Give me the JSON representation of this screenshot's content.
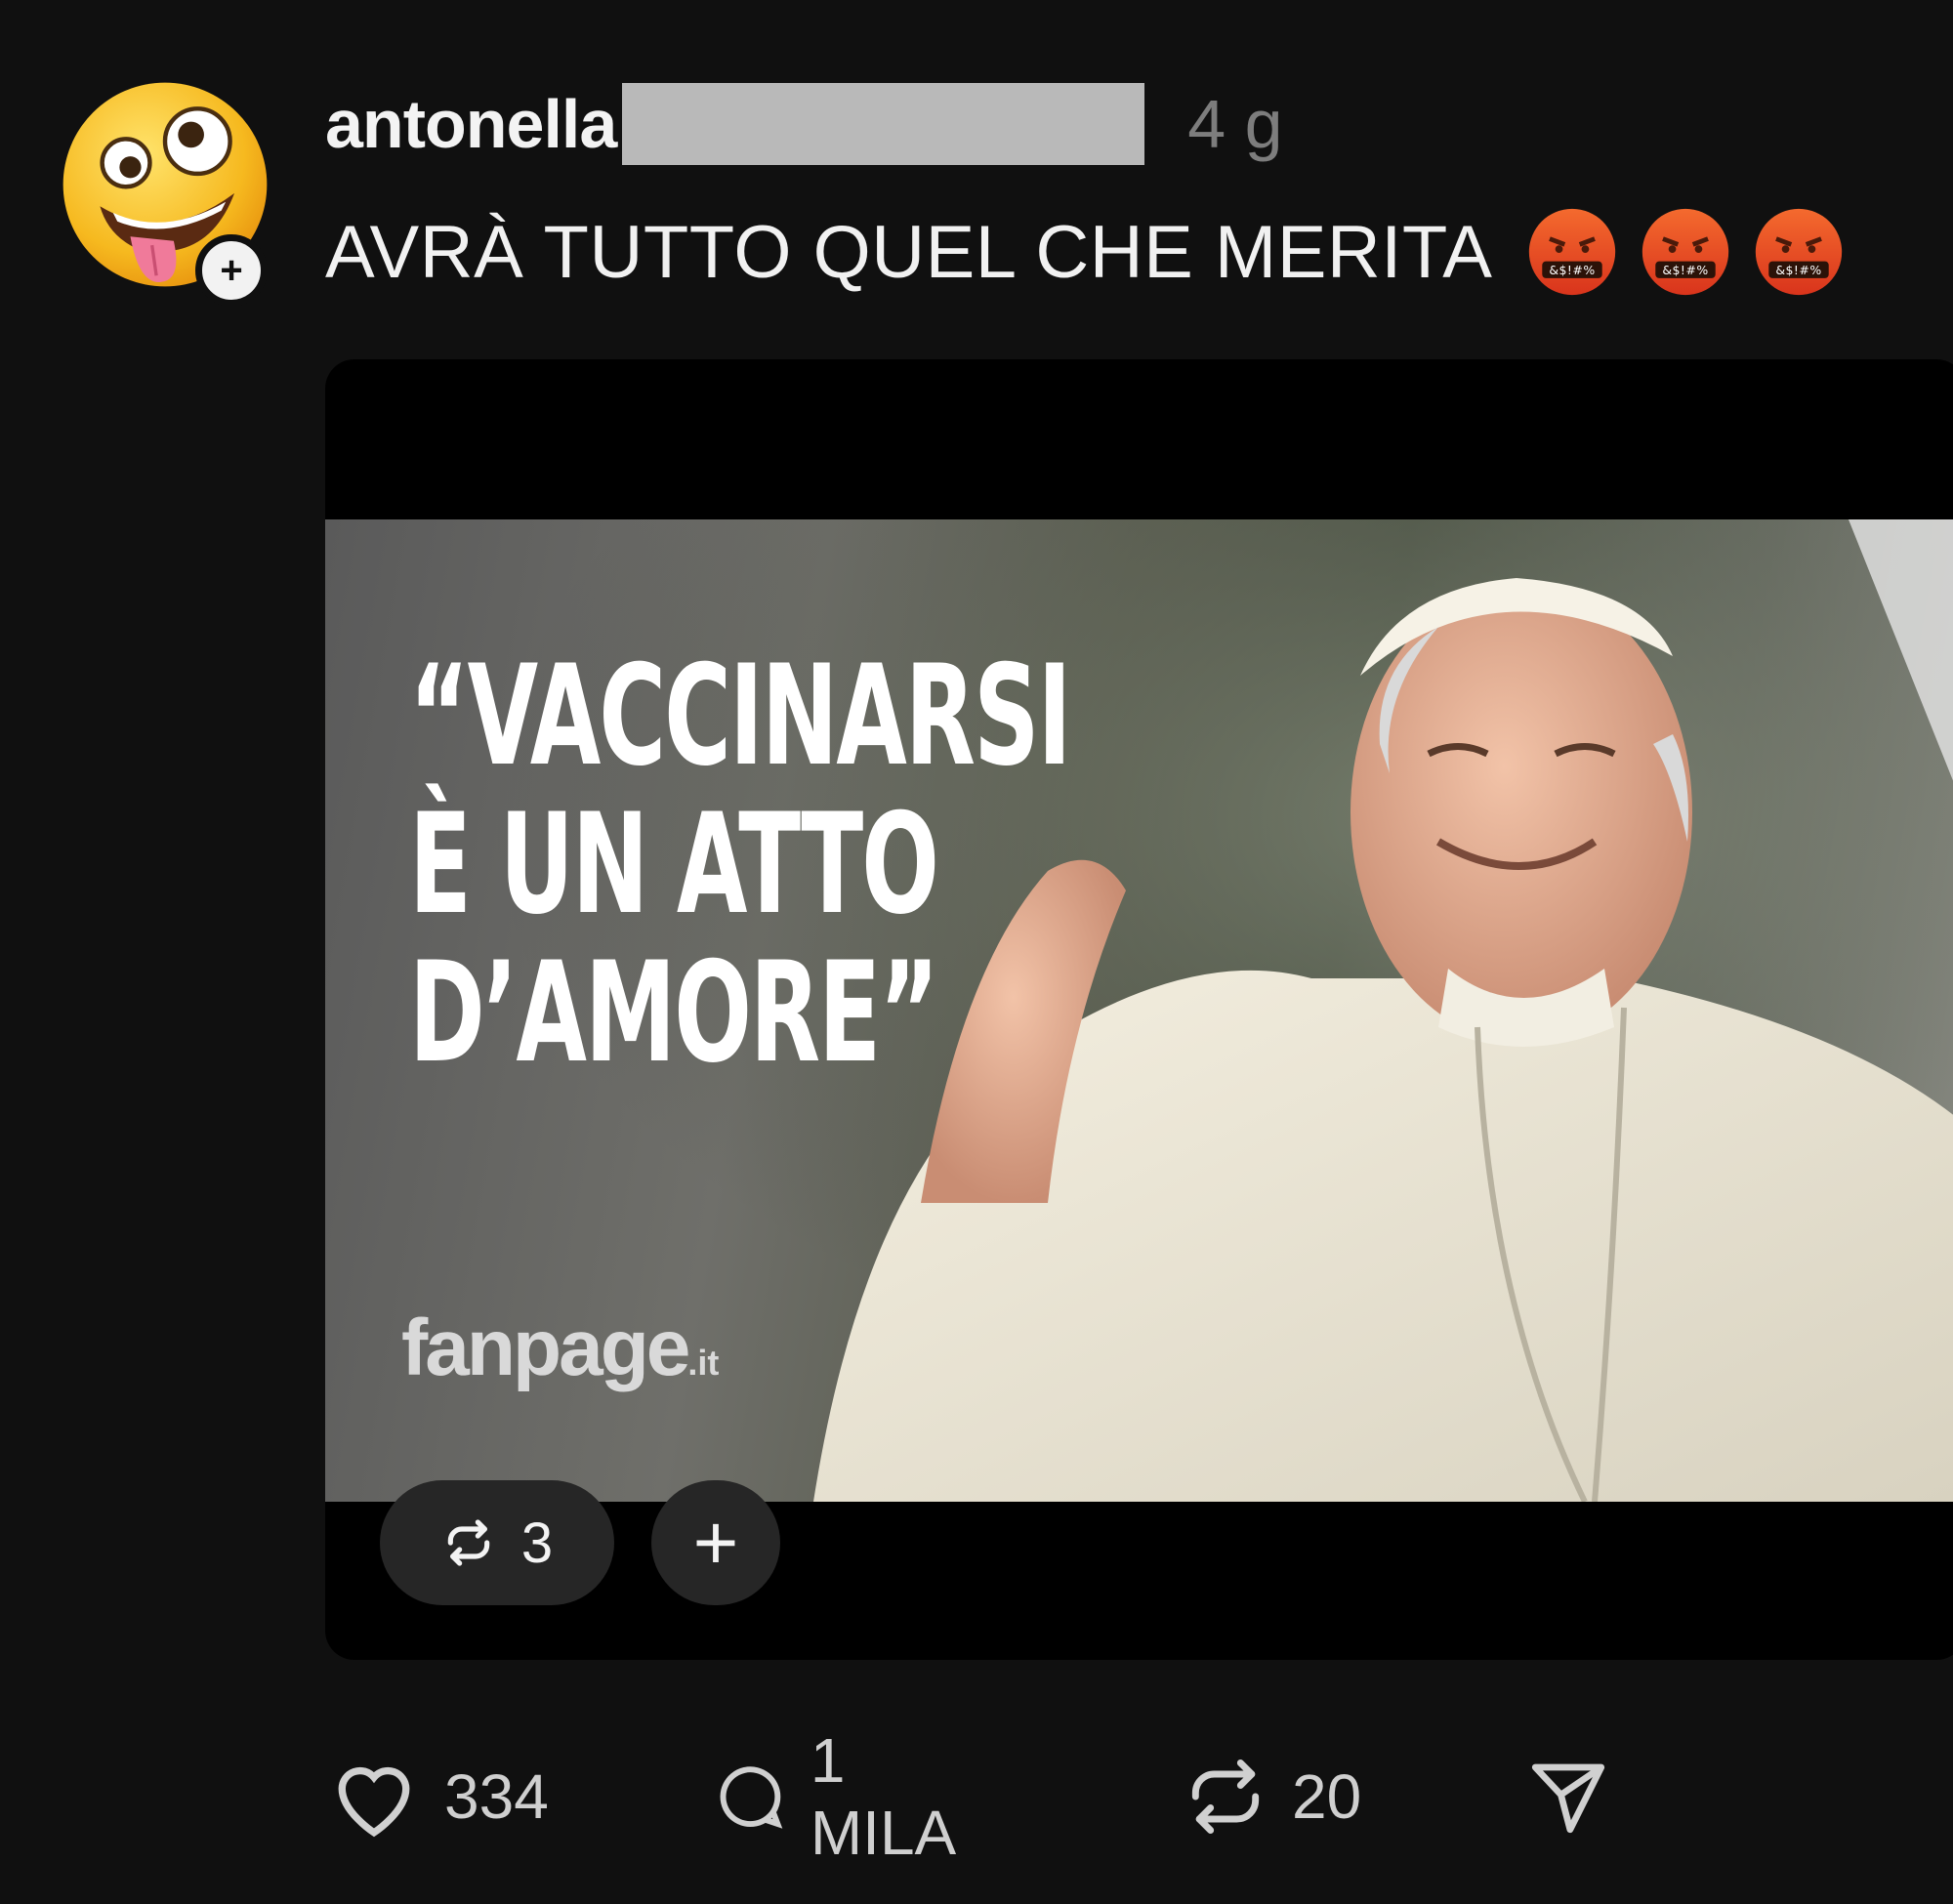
{
  "post": {
    "author": {
      "username": "antonella",
      "avatar_icon": "zany-face-emoji",
      "follow_icon": "plus-icon"
    },
    "time_ago": "4 g",
    "text": "AVRÀ TUTTO QUEL CHE MERITA",
    "text_emojis": [
      "face-with-symbols-on-mouth-emoji",
      "face-with-symbols-on-mouth-emoji",
      "face-with-symbols-on-mouth-emoji"
    ],
    "media": {
      "headline_lines": [
        "“VACCINARSI",
        "È UN ATTO",
        "D’AMORE”"
      ],
      "brand": "fanpage",
      "brand_suffix": ".it",
      "repost_count": "3",
      "add_label": "+"
    },
    "actions": {
      "likes": "334",
      "comments": "1 MILA",
      "reposts": "20"
    }
  },
  "colors": {
    "background": "#101010",
    "text": "#f3f3f3",
    "muted": "#7d7d7d",
    "redaction": "#b9b9b9",
    "pill": "#262626"
  }
}
